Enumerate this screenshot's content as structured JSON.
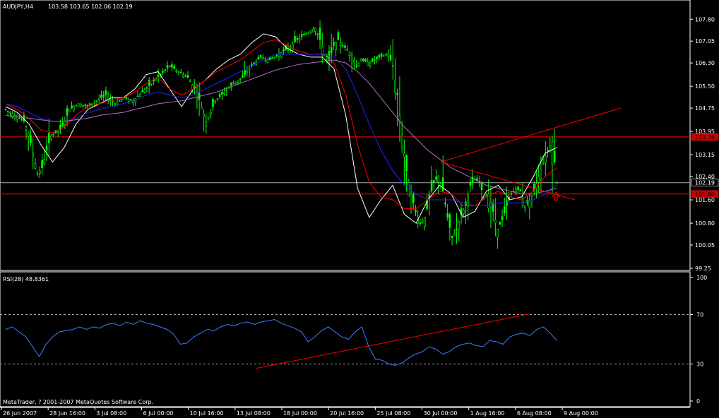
{
  "chart_data": [
    {
      "type": "candlestick",
      "title": "AUDJPY,H4",
      "ohlc_label": "103.58 103.65 102.06 102.19",
      "ylim": [
        99.25,
        108.0
      ],
      "y_ticks": [
        "107.80",
        "107.05",
        "106.30",
        "105.50",
        "104.75",
        "103.95",
        "103.15",
        "102.40",
        "101.60",
        "100.80",
        "100.05",
        "99.25"
      ],
      "x_ticks": [
        "26 Jun 2007",
        "28 Jun 16:00",
        "3 Jul 08:00",
        "6 Jul 00:00",
        "10 Jul 16:00",
        "13 Jul 08:00",
        "18 Jul 00:00",
        "20 Jul 16:00",
        "25 Jul 08:00",
        "30 Jul 00:00",
        "1 Aug 16:00",
        "6 Aug 08:00",
        "9 Aug 00:00"
      ],
      "price_labels": {
        "upper_resistance": "103.76",
        "current": "102.19",
        "lower_support": "101.80"
      },
      "close_path": [
        [
          0,
          104.7
        ],
        [
          2,
          104.5
        ],
        [
          4,
          104.3
        ],
        [
          5,
          103.9
        ],
        [
          6,
          103.2
        ],
        [
          7,
          102.5
        ],
        [
          8,
          102.7
        ],
        [
          9,
          103.3
        ],
        [
          10,
          103.8
        ],
        [
          12,
          104.0
        ],
        [
          13,
          104.3
        ],
        [
          14,
          104.7
        ],
        [
          16,
          104.9
        ],
        [
          18,
          104.8
        ],
        [
          20,
          105.0
        ],
        [
          22,
          105.2
        ],
        [
          24,
          104.9
        ],
        [
          26,
          105.1
        ],
        [
          28,
          105.0
        ],
        [
          30,
          105.3
        ],
        [
          32,
          105.6
        ],
        [
          34,
          105.9
        ],
        [
          36,
          106.2
        ],
        [
          38,
          106.0
        ],
        [
          40,
          105.8
        ],
        [
          42,
          105.3
        ],
        [
          43,
          104.8
        ],
        [
          44,
          104.3
        ],
        [
          45,
          104.6
        ],
        [
          46,
          105.0
        ],
        [
          48,
          105.3
        ],
        [
          50,
          105.6
        ],
        [
          52,
          105.8
        ],
        [
          54,
          106.2
        ],
        [
          56,
          106.5
        ],
        [
          58,
          106.4
        ],
        [
          60,
          106.6
        ],
        [
          62,
          106.8
        ],
        [
          64,
          107.1
        ],
        [
          66,
          107.3
        ],
        [
          68,
          107.5
        ],
        [
          69,
          107.1
        ],
        [
          70,
          106.6
        ],
        [
          71,
          106.4
        ],
        [
          72,
          106.9
        ],
        [
          73,
          107.1
        ],
        [
          74,
          106.9
        ],
        [
          76,
          106.6
        ],
        [
          77,
          106.2
        ],
        [
          78,
          106.4
        ],
        [
          80,
          106.3
        ],
        [
          82,
          106.5
        ],
        [
          84,
          106.6
        ],
        [
          85,
          106.2
        ],
        [
          86,
          105.2
        ],
        [
          87,
          103.8
        ],
        [
          88,
          102.6
        ],
        [
          89,
          101.8
        ],
        [
          90,
          101.2
        ],
        [
          91,
          100.8
        ],
        [
          92,
          101.0
        ],
        [
          93,
          101.6
        ],
        [
          94,
          102.2
        ],
        [
          95,
          102.4
        ],
        [
          96,
          101.9
        ],
        [
          97,
          101.0
        ],
        [
          98,
          100.3
        ],
        [
          99,
          100.6
        ],
        [
          100,
          101.1
        ],
        [
          101,
          101.4
        ],
        [
          102,
          102.1
        ],
        [
          103,
          102.3
        ],
        [
          104,
          102.2
        ],
        [
          105,
          101.7
        ],
        [
          106,
          101.8
        ],
        [
          107,
          101.2
        ],
        [
          108,
          100.6
        ],
        [
          109,
          100.9
        ],
        [
          110,
          101.4
        ],
        [
          111,
          101.8
        ],
        [
          112,
          102.0
        ],
        [
          113,
          101.9
        ],
        [
          114,
          101.4
        ],
        [
          115,
          101.6
        ],
        [
          116,
          101.9
        ],
        [
          117,
          102.4
        ],
        [
          118,
          102.9
        ],
        [
          119,
          103.3
        ],
        [
          120,
          103.6
        ],
        [
          121,
          102.2
        ]
      ],
      "overlays": [
        {
          "color": "#ffffff",
          "values": [
            104.8,
            104.6,
            104.2,
            103.5,
            102.9,
            103.4,
            104.2,
            104.7,
            104.9,
            105.1,
            105.1,
            105.4,
            105.9,
            106.0,
            105.4,
            104.8,
            105.4,
            105.7,
            106.1,
            106.4,
            106.6,
            107.0,
            107.3,
            107.2,
            106.8,
            106.6,
            106.5,
            106.5,
            106.1,
            104.5,
            102.0,
            101.0,
            101.6,
            102.1,
            101.1,
            100.8,
            101.6,
            102.1,
            101.8,
            101.0,
            101.2,
            101.9,
            102.1,
            101.6,
            101.7,
            102.4,
            103.2,
            103.4
          ]
        },
        {
          "color": "#ff0000",
          "values": [
            104.9,
            104.7,
            104.4,
            104.0,
            103.9,
            104.1,
            104.5,
            104.8,
            104.9,
            105.0,
            105.1,
            105.3,
            105.6,
            105.8,
            105.4,
            105.2,
            105.4,
            105.7,
            106.0,
            106.2,
            106.4,
            106.7,
            107.0,
            107.1,
            106.9,
            106.7,
            106.6,
            106.6,
            106.3,
            105.2,
            103.5,
            102.2,
            101.7,
            101.6,
            101.3,
            101.3,
            101.6,
            101.9,
            101.8,
            101.4,
            101.4,
            101.7,
            101.9,
            101.7,
            101.6,
            101.9,
            102.4,
            102.7
          ]
        },
        {
          "color": "#2222ff",
          "values": [
            104.9,
            104.8,
            104.6,
            104.4,
            104.3,
            104.3,
            104.4,
            104.6,
            104.7,
            104.8,
            104.9,
            105.0,
            105.2,
            105.3,
            105.2,
            105.1,
            105.2,
            105.4,
            105.6,
            105.8,
            106.0,
            106.2,
            106.4,
            106.6,
            106.6,
            106.6,
            106.6,
            106.6,
            106.5,
            106.1,
            105.2,
            104.2,
            103.3,
            102.6,
            102.1,
            101.8,
            101.6,
            101.6,
            101.6,
            101.5,
            101.4,
            101.4,
            101.5,
            101.5,
            101.5,
            101.6,
            101.8,
            102.1
          ]
        },
        {
          "color": "#b070c0",
          "values": [
            104.5,
            104.45,
            104.4,
            104.35,
            104.3,
            104.3,
            104.35,
            104.4,
            104.5,
            104.55,
            104.6,
            104.7,
            104.8,
            104.9,
            104.95,
            105.0,
            105.1,
            105.2,
            105.3,
            105.45,
            105.6,
            105.75,
            105.9,
            106.05,
            106.15,
            106.25,
            106.3,
            106.35,
            106.4,
            106.3,
            106.0,
            105.6,
            105.1,
            104.6,
            104.1,
            103.7,
            103.3,
            103.0,
            102.7,
            102.5,
            102.3,
            102.1,
            102.0,
            101.9,
            101.8,
            101.8,
            101.9,
            102.0
          ]
        }
      ],
      "trendlines": [
        {
          "color": "#ff0000",
          "points": [
            [
              95.5,
              102.9
            ],
            [
              125.0,
              101.6
            ]
          ]
        },
        {
          "color": "#ff0000",
          "points": [
            [
              95.5,
              102.9
            ],
            [
              135.0,
              104.75
            ]
          ]
        }
      ],
      "horizontal_lines": [
        {
          "color": "#ff0000",
          "value": 103.76
        },
        {
          "color": "#aaaaaa",
          "value": 102.19
        },
        {
          "color": "#ff0000",
          "value": 101.8
        }
      ]
    },
    {
      "type": "line",
      "title": "RSI(28) 48.8361",
      "ylim": [
        0,
        100
      ],
      "y_ticks": [
        "100",
        "70",
        "30",
        "0"
      ],
      "levels": [
        70,
        30
      ],
      "series": [
        {
          "color": "#3a7fff",
          "values": [
            58,
            60,
            56,
            52,
            44,
            36,
            46,
            52,
            56,
            57,
            58,
            60,
            58,
            60,
            59,
            62,
            63,
            61,
            64,
            62,
            65,
            63,
            62,
            60,
            58,
            54,
            46,
            47,
            52,
            55,
            58,
            57,
            60,
            62,
            61,
            63,
            64,
            62,
            64,
            65,
            66,
            63,
            61,
            59,
            56,
            48,
            52,
            57,
            60,
            56,
            52,
            50,
            56,
            60,
            44,
            34,
            33,
            30,
            29,
            31,
            35,
            38,
            40,
            44,
            42,
            38,
            40,
            44,
            46,
            47,
            45,
            44,
            49,
            48,
            46,
            52,
            54,
            55,
            53,
            58,
            60,
            55,
            49
          ]
        }
      ],
      "trendlines": [
        {
          "color": "#ff0000",
          "points": [
            [
              55,
              26.5
            ],
            [
              115,
              70.5
            ]
          ]
        }
      ]
    }
  ],
  "footer": {
    "copyright": "MetaTrader, ? 2001-2007 MetaQuotes Software Corp."
  },
  "theme": {
    "background": "#000000",
    "axis": "#ffffff",
    "bull_candle": "#00ff00",
    "rsi_level": "#aaaaaa",
    "arrow": "#ff0000",
    "label_fill": "#cc0000"
  }
}
